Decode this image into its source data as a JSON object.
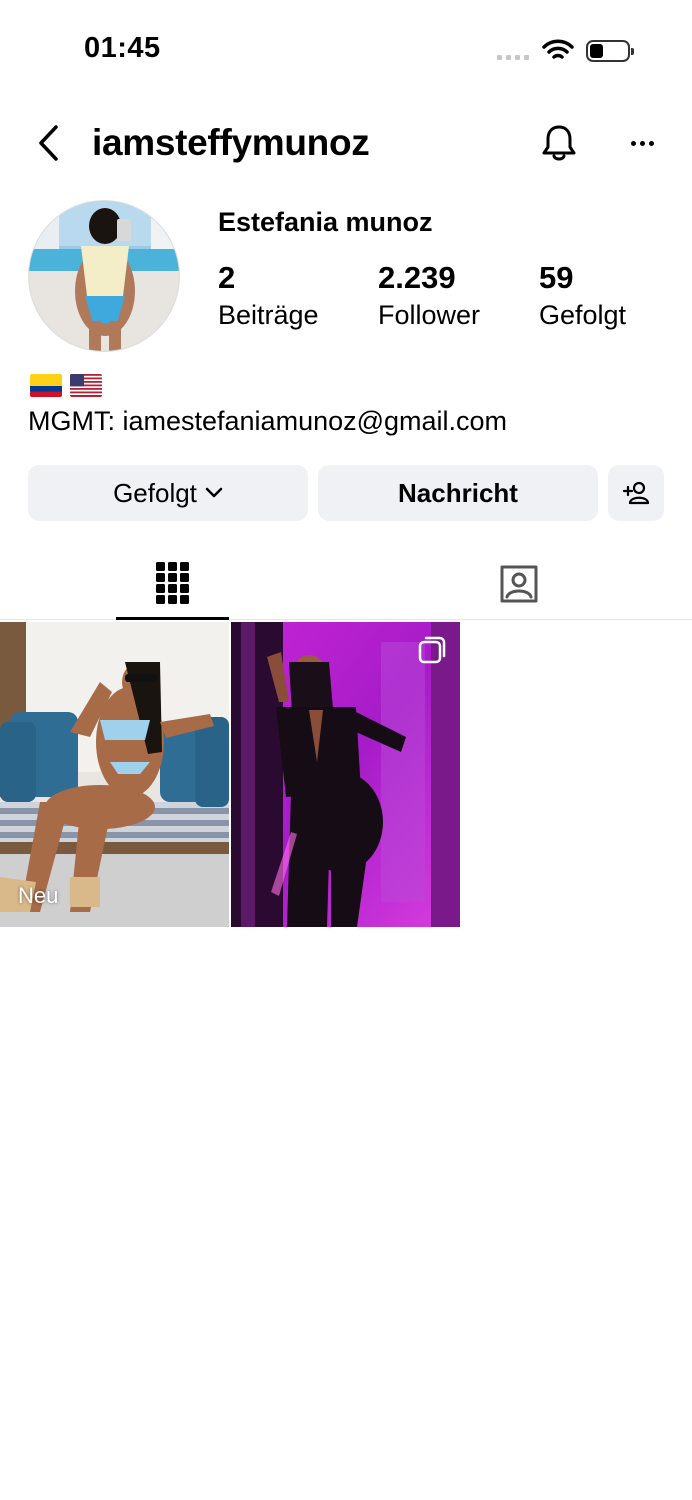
{
  "status_bar": {
    "time": "01:45"
  },
  "header": {
    "username": "iamsteffymunoz"
  },
  "profile": {
    "display_name": "Estefania munoz",
    "stats": [
      {
        "value": "2",
        "label": "Beiträge"
      },
      {
        "value": "2.239",
        "label": "Follower"
      },
      {
        "value": "59",
        "label": "Gefolgt"
      }
    ],
    "bio_flags": [
      "colombia-flag",
      "usa-flag"
    ],
    "bio": "MGMT: iamestefaniamunoz@gmail.com"
  },
  "actions": {
    "follow_label": "Gefolgt",
    "message_label": "Nachricht"
  },
  "tabs": [
    {
      "icon": "grid-icon",
      "active": true
    },
    {
      "icon": "tagged-icon",
      "active": false
    }
  ],
  "posts": [
    {
      "badge": "Neu",
      "multi": false
    },
    {
      "badge": "",
      "multi": true
    }
  ]
}
